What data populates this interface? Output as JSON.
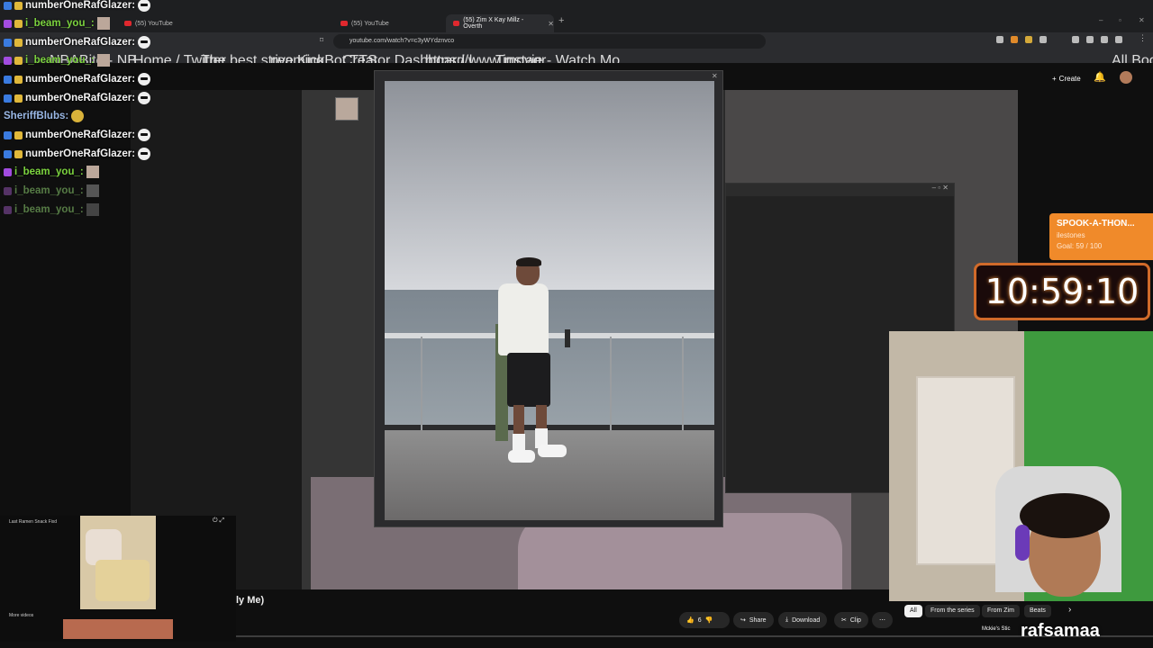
{
  "browser": {
    "tabs": [
      {
        "label": "(55) YouTube"
      },
      {
        "label": "(55) YouTube"
      },
      {
        "label": "(55) Zim X Kay Millz - Overth"
      }
    ],
    "url": "youtube.com/watch?v=c3yWYdznvco",
    "bookmarks": [
      "NBABite - NB",
      "Home / Twitter",
      "The best streaming...",
      "rive",
      "KickBot TTS",
      "Creator Dashboard |...",
      "https://www.instagr...",
      "Tmovie - Watch Mo..."
    ],
    "all_bookmarks": "All Bookmarks"
  },
  "youtube": {
    "create": "Create",
    "title_fragment": "ly Me)",
    "likes": "6",
    "share": "Share",
    "download": "Download",
    "clip": "Clip",
    "filters": [
      "All",
      "From the series",
      "From Zim",
      "Beats"
    ],
    "mini_player_title": "Last Ramen Snack Fixd",
    "mini_more": "More videos"
  },
  "chat": [
    {
      "user": "numberOneRafGlazer:",
      "color": "white"
    },
    {
      "user": "i_beam_you_:",
      "color": "green"
    },
    {
      "user": "numberOneRafGlazer:",
      "color": "white"
    },
    {
      "user": "i_beam_you_:",
      "color": "green"
    },
    {
      "user": "numberOneRafGlazer:",
      "color": "white"
    },
    {
      "user": "numberOneRafGlazer:",
      "color": "white"
    },
    {
      "user": "SheriffBlubs:",
      "color": "blue"
    },
    {
      "user": "numberOneRafGlazer:",
      "color": "white"
    },
    {
      "user": "numberOneRafGlazer:",
      "color": "white"
    },
    {
      "user": "i_beam_you_:",
      "color": "green"
    },
    {
      "user": "i_beam_you_:",
      "color": "faded"
    },
    {
      "user": "i_beam_you_:",
      "color": "faded"
    }
  ],
  "overlay": {
    "goal_title": "SPOOK-A-THON...",
    "goal_sub": "ilestones",
    "goal_progress": "Goal: 59 / 100",
    "timer": "10:59:10",
    "streamer": "rafsamaa",
    "mention": "Mckie's Stic"
  },
  "colors": {
    "accent": "#e0282e",
    "goal": "#f08a2a"
  }
}
